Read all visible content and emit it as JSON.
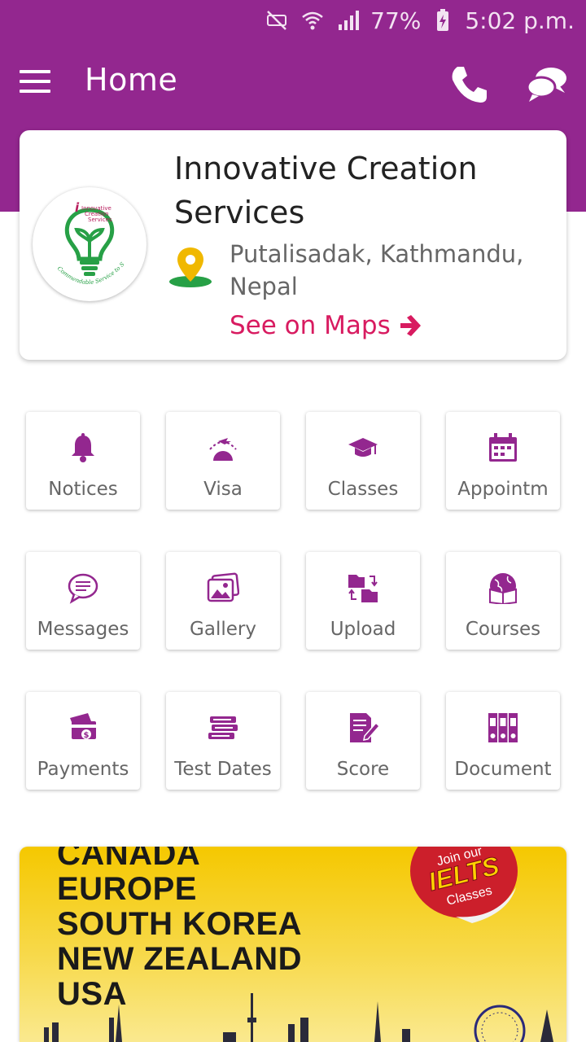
{
  "status_bar": {
    "battery": "77%",
    "time": "5:02 p.m."
  },
  "app_bar": {
    "title": "Home"
  },
  "profile": {
    "company_name": "Innovative Creation Services",
    "address": "Putalisadak, Kathmandu, Nepal",
    "maps_link": "See on Maps",
    "logo_text": [
      "Innovative",
      "Creation",
      "Services"
    ],
    "logo_tagline": "Commendable Service to Society"
  },
  "grid": [
    {
      "label": "Notices",
      "icon": "bell-icon"
    },
    {
      "label": "Visa",
      "icon": "globe-plane-icon"
    },
    {
      "label": "Classes",
      "icon": "graduation-cap-icon"
    },
    {
      "label": "Appointm",
      "icon": "calendar-icon"
    },
    {
      "label": "Messages",
      "icon": "chat-bubble-icon"
    },
    {
      "label": "Gallery",
      "icon": "gallery-icon"
    },
    {
      "label": "Upload",
      "icon": "folder-transfer-icon"
    },
    {
      "label": "Courses",
      "icon": "globe-book-icon"
    },
    {
      "label": "Payments",
      "icon": "payment-card-icon"
    },
    {
      "label": "Test Dates",
      "icon": "book-stack-icon"
    },
    {
      "label": "Score",
      "icon": "edit-document-icon"
    },
    {
      "label": "Document",
      "icon": "binders-icon"
    }
  ],
  "banner": {
    "countries": [
      "CANADA",
      "EUROPE",
      "SOUTH KOREA",
      "NEW ZEALAND",
      "USA"
    ],
    "badge_line1": "Join our",
    "badge_line2": "IELTS",
    "badge_line3": "Classes"
  },
  "colors": {
    "primary": "#93278f",
    "accent": "#d81b60",
    "banner_yellow": "#f5c800"
  }
}
